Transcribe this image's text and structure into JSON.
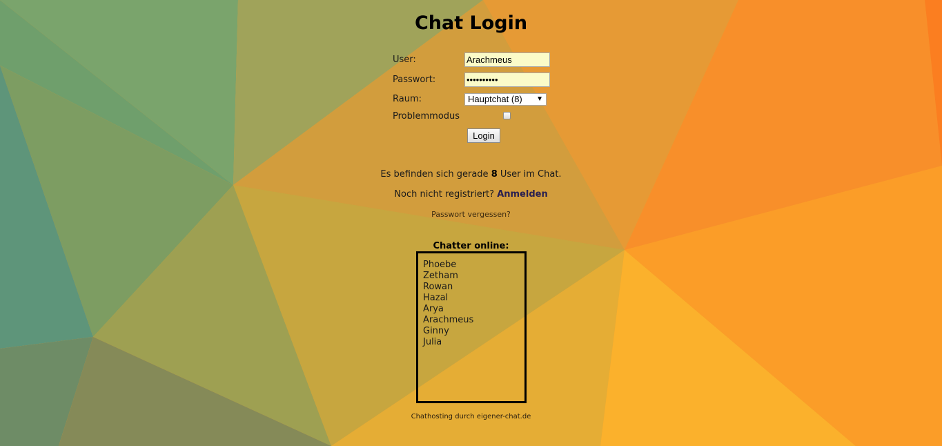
{
  "page": {
    "title": "Chat Login"
  },
  "form": {
    "user_label": "User:",
    "user_value": "Arachmeus",
    "password_label": "Passwort:",
    "password_value": "••••••••••",
    "room_label": "Raum:",
    "room_selected": "Hauptchat (8)",
    "problem_mode_label": "Problemmodus",
    "problem_mode_checked": false,
    "login_button": "Login"
  },
  "info": {
    "count_prefix": "Es befinden sich gerade ",
    "count_value": "8",
    "count_suffix": " User im Chat.",
    "register_prefix": "Noch nicht registriert? ",
    "register_link": "Anmelden",
    "forgot_link": "Passwort vergessen?"
  },
  "chatters": {
    "heading": "Chatter online:",
    "names": [
      "Phoebe",
      "Zetham",
      "Rowan",
      "Hazal",
      "Arya",
      "Arachmeus",
      "Ginny",
      "Julia"
    ]
  },
  "footer": {
    "text": "Chathosting durch eigener-chat.de"
  },
  "colors": {
    "input_background": "#fbfbc8",
    "background_left": "#5b9a78",
    "background_right": "#fb8a22"
  },
  "icons": {
    "select_arrow": "chevron-down-icon"
  }
}
